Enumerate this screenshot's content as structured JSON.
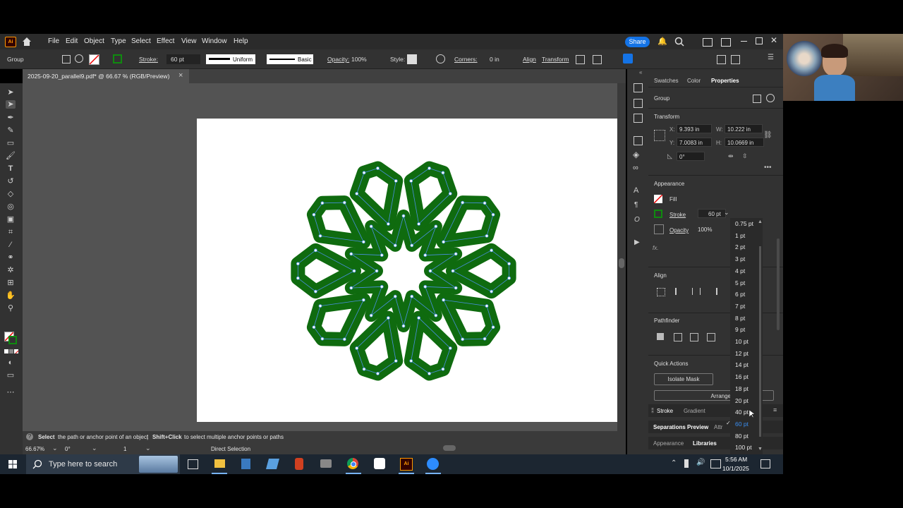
{
  "menu": {
    "app_logo": "Ai",
    "items": [
      "File",
      "Edit",
      "Object",
      "Type",
      "Select",
      "Effect",
      "View",
      "Window",
      "Help"
    ],
    "share_label": "Share"
  },
  "control_bar": {
    "selection_type": "Group",
    "stroke_label": "Stroke:",
    "stroke_value": "60 pt",
    "profile_label": "Uniform",
    "brush_label": "Basic",
    "opacity_label": "Opacity:",
    "opacity_value": "100%",
    "style_label": "Style:",
    "corners_label": "Corners:",
    "corners_value": "0 in",
    "align_label": "Align",
    "transform_label": "Transform"
  },
  "document": {
    "tab_title": "2025-09-20_parallel9.pdf* @ 66.67 % (RGB/Preview)",
    "close_glyph": "×"
  },
  "artwork": {
    "stroke_color": "#0f6b0f",
    "path_color": "#4a90e2",
    "points": 10
  },
  "status": {
    "hint_bold": "Select",
    "hint_text": "the path or anchor point of an object",
    "hint_sep": "|",
    "hint_bold2": "Shift+Click",
    "hint_text2": "to select multiple anchor points or paths",
    "zoom": "66.67%",
    "rotation": "0°",
    "artboard_num": "1",
    "tool_name": "Direct Selection"
  },
  "panel": {
    "tabs": [
      "Swatches",
      "Color",
      "Properties"
    ],
    "group_label": "Group",
    "transform_title": "Transform",
    "x_label": "X:",
    "x_value": "9.393 in",
    "y_label": "Y:",
    "y_value": "7.0083 in",
    "w_label": "W:",
    "w_value": "10.222 in",
    "h_label": "H:",
    "h_value": "10.0669 in",
    "angle_value": "0°",
    "appearance_title": "Appearance",
    "fill_label": "Fill",
    "stroke_label": "Stroke",
    "stroke_value": "60 pt",
    "opacity_label": "Opacity",
    "opacity_value": "100%",
    "fx_label": "fx.",
    "align_title": "Align",
    "pathfinder_title": "Pathfinder",
    "quick_actions_title": "Quick Actions",
    "isolate_mask_label": "Isolate Mask",
    "arrange_label": "Arrange",
    "bottom_tabs_1": [
      "Stroke",
      "Gradient"
    ],
    "bottom_tabs_2": [
      "Separations Preview",
      "Attr"
    ],
    "bottom_tabs_3": [
      "Appearance",
      "Libraries"
    ]
  },
  "stroke_dropdown": {
    "options": [
      "0.75 pt",
      "1 pt",
      "2 pt",
      "3 pt",
      "4 pt",
      "5 pt",
      "6 pt",
      "7 pt",
      "8 pt",
      "9 pt",
      "10 pt",
      "12 pt",
      "14 pt",
      "16 pt",
      "18 pt",
      "20 pt",
      "40 pt",
      "60 pt",
      "80 pt",
      "100 pt"
    ],
    "selected": "60 pt"
  },
  "taskbar": {
    "search_placeholder": "Type here to search",
    "time": "5:56 AM",
    "date": "10/1/2025"
  },
  "colors": {
    "accent": "#1473e6",
    "app_orange": "#ff9a00",
    "app_bg": "#320000"
  }
}
